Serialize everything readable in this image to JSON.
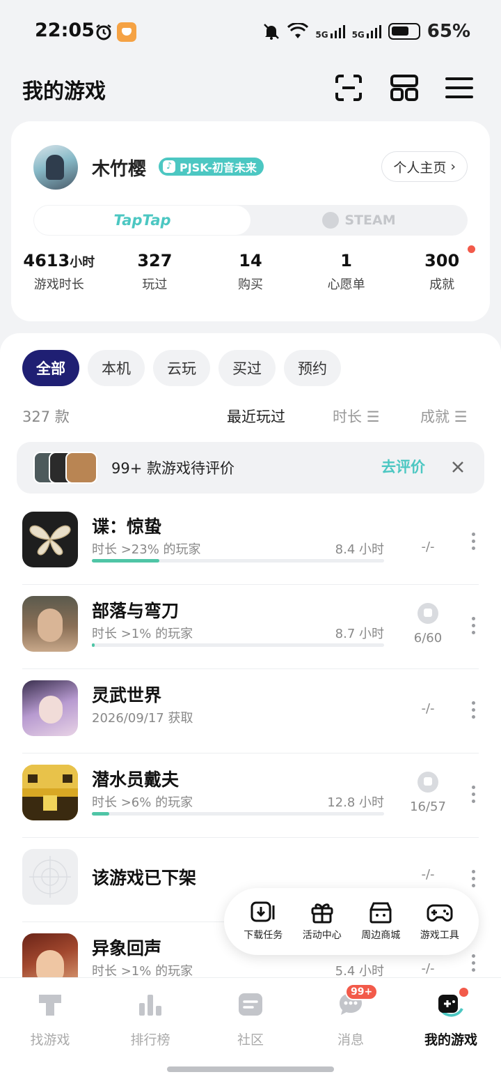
{
  "status_bar": {
    "time": "22:05",
    "sim1": "5G",
    "sim2": "5G",
    "battery": "65%"
  },
  "header": {
    "title": "我的游戏"
  },
  "profile": {
    "name": "木竹樱",
    "tag": "PJSK-初音未来",
    "home_button": "个人主页",
    "platforms": {
      "active": "TapTap",
      "other": "STEAM"
    },
    "stats": [
      {
        "value": "4613",
        "unit": "小时",
        "label": "游戏时长"
      },
      {
        "value": "327",
        "unit": "",
        "label": "玩过"
      },
      {
        "value": "14",
        "unit": "",
        "label": "购买"
      },
      {
        "value": "1",
        "unit": "",
        "label": "心愿单"
      },
      {
        "value": "300",
        "unit": "",
        "label": "成就"
      }
    ]
  },
  "filters": [
    "全部",
    "本机",
    "云玩",
    "买过",
    "预约"
  ],
  "sort": {
    "count": "327 款",
    "recent": "最近玩过",
    "duration": "时长",
    "achievement": "成就"
  },
  "review_prompt": {
    "text": "99+ 款游戏待评价",
    "button": "去评价"
  },
  "games": [
    {
      "title": "谍：惊蛰",
      "subtitle": "时长 >23% 的玩家",
      "hours": "8.4 小时",
      "progress": 0.23,
      "achievements": "-/-",
      "trophy": false,
      "icon_color": "#1e1e1e"
    },
    {
      "title": "部落与弯刀",
      "subtitle": "时长 >1% 的玩家",
      "hours": "8.7 小时",
      "progress": 0.01,
      "achievements": "6/60",
      "trophy": true,
      "icon_color": "#7a6a58"
    },
    {
      "title": "灵武世界",
      "subtitle": "2026/09/17 获取",
      "hours": "",
      "progress": null,
      "achievements": "-/-",
      "trophy": false,
      "icon_color": "#b79ad0"
    },
    {
      "title": "潜水员戴夫",
      "subtitle": "时长 >6% 的玩家",
      "hours": "12.8 小时",
      "progress": 0.06,
      "achievements": "16/57",
      "trophy": true,
      "icon_color": "#d8a824"
    },
    {
      "title": "该游戏已下架",
      "subtitle": "",
      "hours": "",
      "progress": null,
      "achievements": "-/-",
      "trophy": false,
      "icon_color": "#eeeff1"
    },
    {
      "title": "异象回声",
      "subtitle": "时长 >1% 的玩家",
      "hours": "5.4 小时",
      "progress": 0.01,
      "achievements": "-/-",
      "trophy": false,
      "icon_color": "#a2482e"
    }
  ],
  "float_menu": [
    "下载任务",
    "活动中心",
    "周边商城",
    "游戏工具"
  ],
  "bottom_nav": [
    {
      "label": "找游戏",
      "icon": "tap-logo-icon"
    },
    {
      "label": "排行榜",
      "icon": "ranking-icon"
    },
    {
      "label": "社区",
      "icon": "community-icon"
    },
    {
      "label": "消息",
      "icon": "message-icon",
      "badge": "99+"
    },
    {
      "label": "我的游戏",
      "icon": "my-games-icon",
      "active": true
    }
  ],
  "colors": {
    "accent": "#4cc7c2",
    "chip_active": "#1f1f73",
    "red_dot": "#f25a4a",
    "progress": "#4fc5a6"
  }
}
